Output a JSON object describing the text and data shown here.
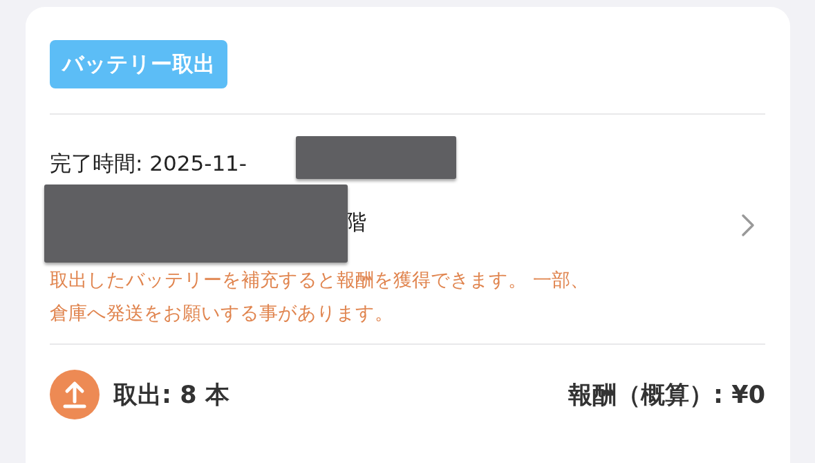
{
  "badge": "バッテリー取出",
  "completion": "完了時間: 2025-11-",
  "address": "階",
  "note_lines": [
    "取出したバッテリーを補充すると報酬を獲得できます。 一部、",
    "倉庫へ発送をお願いする事があります。"
  ],
  "pickup": "取出: 8 本",
  "reward": "報酬（概算）: ¥0"
}
